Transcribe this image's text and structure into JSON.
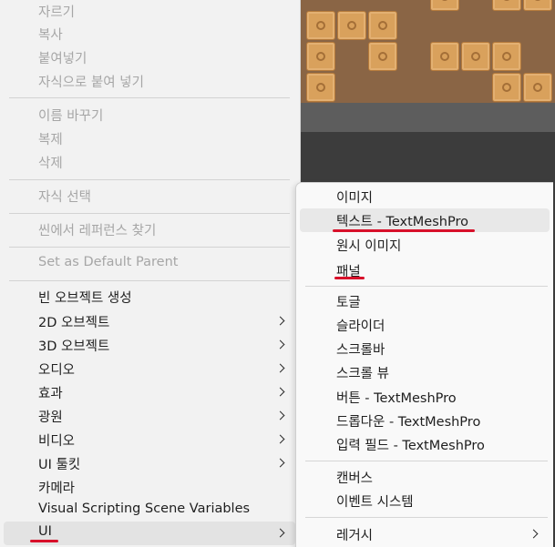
{
  "menu": {
    "items": [
      {
        "label": "자르기"
      },
      {
        "label": "복사"
      },
      {
        "label": "붙여넣기"
      },
      {
        "label": "자식으로 붙여 넣기"
      },
      {
        "label": "이름 바꾸기"
      },
      {
        "label": "복제"
      },
      {
        "label": "삭제"
      },
      {
        "label": "자식 선택"
      },
      {
        "label": "씬에서 레퍼런스 찾기"
      },
      {
        "label": "Set as Default Parent"
      },
      {
        "label": "빈 오브젝트 생성"
      },
      {
        "label": "2D 오브젝트"
      },
      {
        "label": "3D 오브젝트"
      },
      {
        "label": "오디오"
      },
      {
        "label": "효과"
      },
      {
        "label": "광원"
      },
      {
        "label": "비디오"
      },
      {
        "label": "UI 툴킷"
      },
      {
        "label": "카메라"
      },
      {
        "label": "Visual Scripting Scene Variables"
      },
      {
        "label": "UI"
      }
    ]
  },
  "submenu": {
    "items": [
      {
        "label": "이미지"
      },
      {
        "label": "텍스트 - TextMeshPro"
      },
      {
        "label": "원시 이미지"
      },
      {
        "label": "패널"
      },
      {
        "label": "토글"
      },
      {
        "label": "슬라이더"
      },
      {
        "label": "스크롤바"
      },
      {
        "label": "스크롤 뷰"
      },
      {
        "label": "버튼 - TextMeshPro"
      },
      {
        "label": "드롭다운 - TextMeshPro"
      },
      {
        "label": "입력 필드 - TextMeshPro"
      },
      {
        "label": "캔버스"
      },
      {
        "label": "이벤트 시스템"
      },
      {
        "label": "레거시"
      }
    ]
  },
  "colors": {
    "menu_bg": "#f2f2f2",
    "disabled_text": "#a6a6a6",
    "annotation_underline": "#d8102a"
  }
}
